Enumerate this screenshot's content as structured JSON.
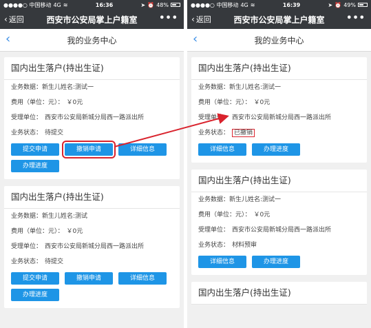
{
  "status_left": {
    "carrier": "●●●●○ 中国移动",
    "network": "4G",
    "time": "16:36",
    "battery": "48%"
  },
  "status_right": {
    "carrier": "●●●●○ 中国移动",
    "network": "4G",
    "time": "16:39",
    "battery": "49%"
  },
  "nav": {
    "back": "返回",
    "title": "西安市公安局掌上户籍室",
    "more": "•••"
  },
  "sub": {
    "back": "‹",
    "title": "我的业务中心"
  },
  "labels": {
    "data": "业务数据：",
    "fee": "费用（单位：元）：",
    "unit": "受理单位：",
    "status": "业务状态："
  },
  "left_cards": [
    {
      "title": "国内出生落户(持出生证)",
      "data": "新生儿姓名:测试一",
      "fee": "￥0元",
      "unit": "西安市公安局新城分局西一路派出所",
      "status": "待提交",
      "buttons": [
        "提交申请",
        "撤销申请",
        "详细信息",
        "办理进度"
      ]
    },
    {
      "title": "国内出生落户(持出生证)",
      "data": "新生儿姓名:测试",
      "fee": "￥0元",
      "unit": "西安市公安局新城分局西一路派出所",
      "status": "待提交",
      "buttons": [
        "提交申请",
        "撤销申请",
        "详细信息",
        "办理进度"
      ]
    }
  ],
  "right_cards": [
    {
      "title": "国内出生落户(持出生证)",
      "data": "新生儿姓名:测试一",
      "fee": "￥0元",
      "unit": "西安市公安局新城分局西一路派出所",
      "status": "已撤销",
      "buttons": [
        "详细信息",
        "办理进度"
      ]
    },
    {
      "title": "国内出生落户(持出生证)",
      "data": "新生儿姓名:测试一",
      "fee": "￥0元",
      "unit": "西安市公安局新城分局西一路派出所",
      "status": "材料预审",
      "buttons": [
        "详细信息",
        "办理进度"
      ]
    },
    {
      "title": "国内出生落户(持出生证)"
    }
  ],
  "colors": {
    "nav_bg": "#36393d",
    "button": "#1e95e6",
    "highlight": "#d9232d"
  }
}
